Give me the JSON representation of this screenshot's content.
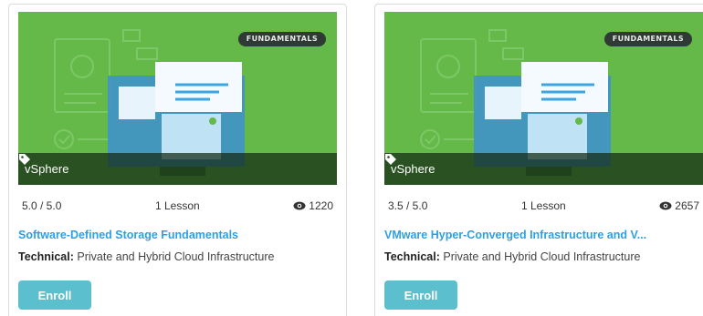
{
  "colors": {
    "thumbnail_bg": "#64b949",
    "title_link": "#2f9fe0",
    "enroll_button": "#5bbfcd",
    "badge_bg": "#2e3a33"
  },
  "cards": [
    {
      "badge": "FUNDAMENTALS",
      "tag": "vSphere",
      "tag_icon": "tag-icon",
      "rating": "5.0 / 5.0",
      "lessons": "1 Lesson",
      "views": "1220",
      "views_icon": "eye-icon",
      "title": "Software-Defined Storage Fundamentals",
      "category_label": "Technical:",
      "category_value": "Private and Hybrid Cloud Infrastructure",
      "enroll_label": "Enroll"
    },
    {
      "badge": "FUNDAMENTALS",
      "tag": "vSphere",
      "tag_icon": "tag-icon",
      "rating": "3.5 / 5.0",
      "lessons": "1 Lesson",
      "views": "2657",
      "views_icon": "eye-icon",
      "title": "VMware Hyper-Converged Infrastructure and V...",
      "category_label": "Technical:",
      "category_value": "Private and Hybrid Cloud Infrastructure",
      "enroll_label": "Enroll"
    }
  ]
}
